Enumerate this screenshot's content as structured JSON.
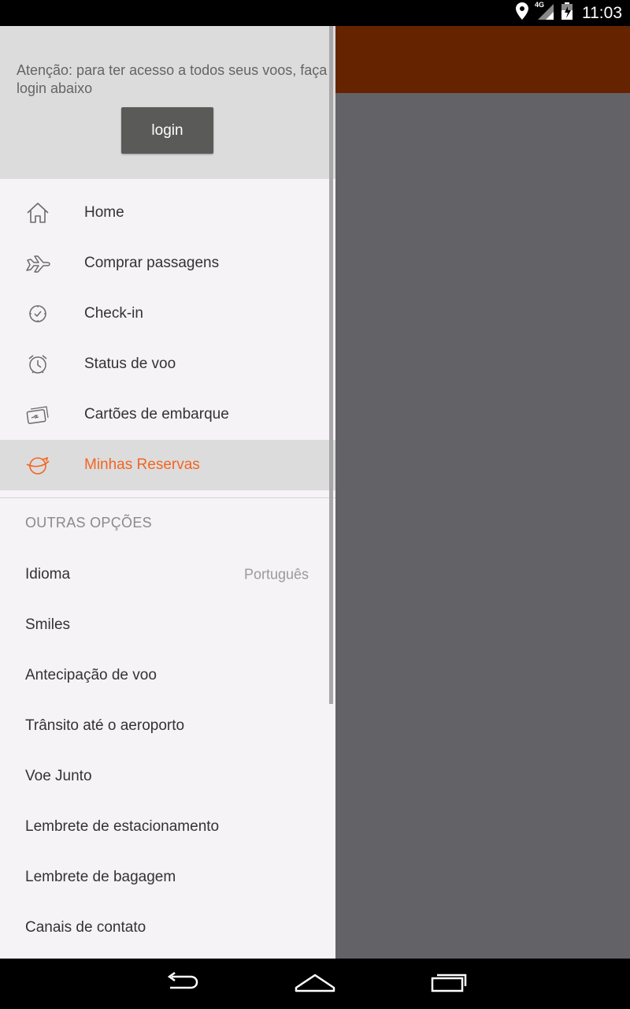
{
  "status_bar": {
    "time": "11:03",
    "network": "4G",
    "icons": [
      "location-icon",
      "signal-icon",
      "battery-icon"
    ]
  },
  "drawer": {
    "notice": "Atenção: para ter acesso a todos seus voos, faça login abaixo",
    "login_label": "login",
    "menu": [
      {
        "label": "Home",
        "icon": "home-icon"
      },
      {
        "label": "Comprar passagens",
        "icon": "airplane-icon"
      },
      {
        "label": "Check-in",
        "icon": "clock-check-icon"
      },
      {
        "label": "Status de voo",
        "icon": "alarm-clock-icon"
      },
      {
        "label": "Cartões de embarque",
        "icon": "boarding-pass-icon"
      },
      {
        "label": "Minhas Reservas",
        "icon": "globe-plane-icon",
        "active": true
      }
    ],
    "section_title": "OUTRAS OPÇÕES",
    "options": [
      {
        "label": "Idioma",
        "value": "Português"
      },
      {
        "label": "Smiles"
      },
      {
        "label": "Antecipação de voo"
      },
      {
        "label": "Trânsito até o aeroporto"
      },
      {
        "label": "Voe Junto"
      },
      {
        "label": "Lembrete de estacionamento"
      },
      {
        "label": "Lembrete de bagagem"
      },
      {
        "label": "Canais de contato"
      }
    ]
  },
  "colors": {
    "accent": "#f26522",
    "appbar": "#662300",
    "scrim": "#636266",
    "drawer_bg": "#f6f3f6",
    "header_bg": "#dddcdd"
  },
  "nav_bar": {
    "icons": [
      "back-icon",
      "home-nav-icon",
      "recent-apps-icon"
    ]
  }
}
